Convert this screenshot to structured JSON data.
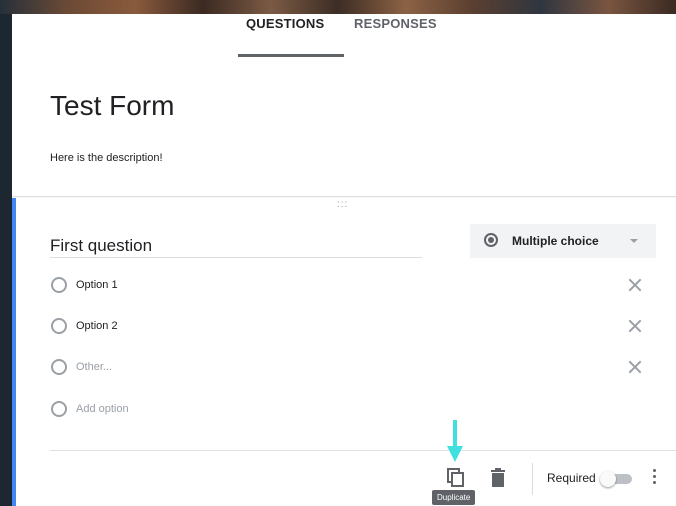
{
  "tabs": {
    "questions": "QUESTIONS",
    "responses": "RESPONSES"
  },
  "form": {
    "title": "Test Form",
    "description": "Here is the description!"
  },
  "question": {
    "title": "First question",
    "type": "Multiple choice",
    "options": [
      {
        "label": "Option 1"
      },
      {
        "label": "Option 2"
      },
      {
        "label": "Other..."
      },
      {
        "label": "Add option"
      }
    ]
  },
  "footer": {
    "required_label": "Required",
    "duplicate_tooltip": "Duplicate"
  },
  "icons": {
    "duplicate": "duplicate-icon",
    "delete": "trash-icon",
    "more": "more-vert-icon",
    "remove": "close-icon",
    "drag": "drag-handle-icon"
  },
  "colors": {
    "accent": "#4285f4",
    "annotation_arrow": "#40e0e0"
  }
}
